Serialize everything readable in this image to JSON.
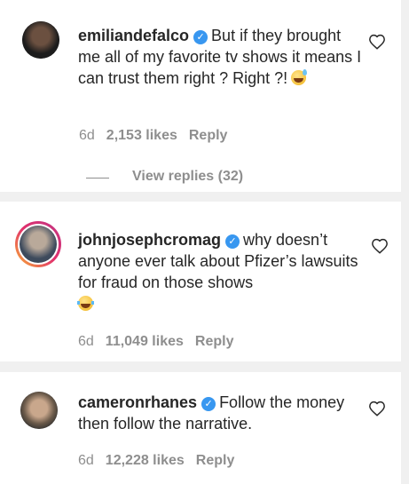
{
  "comments": [
    {
      "username": "emiliandefalco",
      "text": "But if they brought me all of my favorite tv shows it means I can trust them right ? Right ?!",
      "emoji": "sweat-smile-emoji",
      "time": "6d",
      "likes": "2,153 likes",
      "reply": "Reply",
      "view_replies": "View replies (32)"
    },
    {
      "username": "johnjosephcromag",
      "text": "why doesn’t anyone ever talk about Pfizer’s lawsuits for fraud on those shows",
      "emoji": "laughing-crying-emoji",
      "time": "6d",
      "likes": "11,049 likes",
      "reply": "Reply"
    },
    {
      "username": "cameronrhanes",
      "text": "Follow the money then follow the narrative.",
      "time": "6d",
      "likes": "12,228 likes",
      "reply": "Reply"
    }
  ],
  "colors": {
    "text": "#262626",
    "meta": "#8e8e8e",
    "verified": "#3897f0",
    "story_ring": "#c13584"
  }
}
